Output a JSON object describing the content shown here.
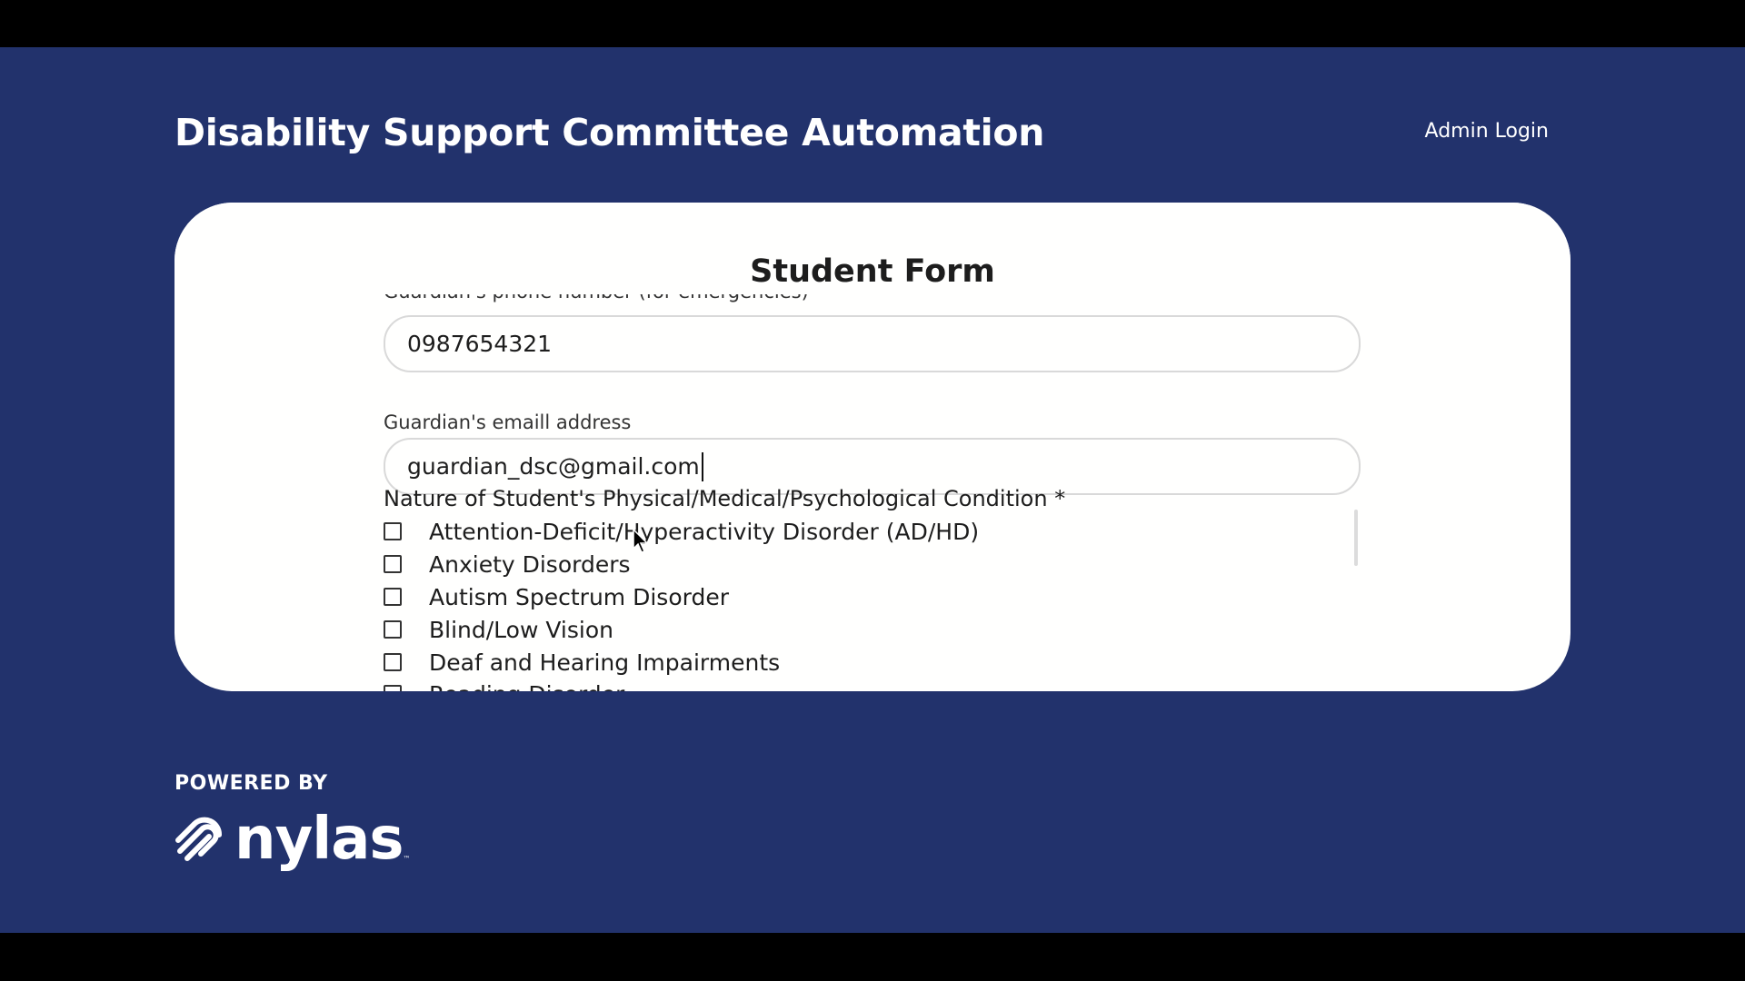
{
  "header": {
    "title": "Disability Support Committee Automation",
    "admin_login": "Admin Login"
  },
  "form": {
    "title": "Student Form",
    "guardian_phone": {
      "label": "Guardian's phone number (for emergencies)",
      "value": "0987654321"
    },
    "guardian_email": {
      "label": "Guardian's emaill address",
      "value": "guardian_dsc@gmail.com"
    },
    "condition": {
      "label": "Nature of Student's Physical/Medical/Psychological Condition *",
      "options": [
        {
          "label": "Attention-Deficit/Hyperactivity Disorder (AD/HD)",
          "checked": false
        },
        {
          "label": "Anxiety Disorders",
          "checked": false
        },
        {
          "label": "Autism Spectrum Disorder",
          "checked": false
        },
        {
          "label": "Blind/Low Vision",
          "checked": false
        },
        {
          "label": "Deaf and Hearing Impairments",
          "checked": false
        },
        {
          "label": "Reading Disorder",
          "checked": false
        }
      ]
    }
  },
  "footer": {
    "powered_by": "POWERED BY",
    "logo_text": "nylas",
    "logo_tm": "™"
  }
}
